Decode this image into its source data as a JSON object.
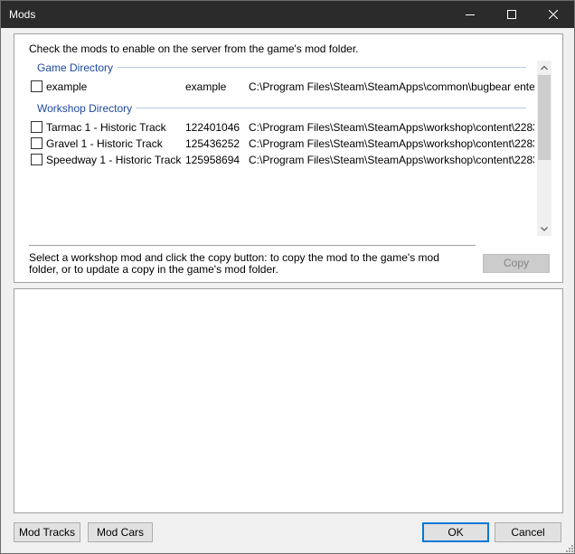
{
  "window": {
    "title": "Mods"
  },
  "instructions": "Check the mods to enable on the server from the game's mod folder.",
  "groups": {
    "game": {
      "title": "Game Directory",
      "rows": [
        {
          "name": "example",
          "id": "example",
          "path": "C:\\Program Files\\Steam\\SteamApps\\common\\bugbear entert...",
          "checked": false
        }
      ]
    },
    "workshop": {
      "title": "Workshop Directory",
      "rows": [
        {
          "name": "Tarmac 1 - Historic Track",
          "id": "122401046",
          "path": "C:\\Program Files\\Steam\\SteamApps\\workshop\\content\\2283...",
          "checked": false
        },
        {
          "name": "Gravel 1 - Historic Track",
          "id": "125436252",
          "path": "C:\\Program Files\\Steam\\SteamApps\\workshop\\content\\2283...",
          "checked": false
        },
        {
          "name": "Speedway 1 - Historic Track",
          "id": "125958694",
          "path": "C:\\Program Files\\Steam\\SteamApps\\workshop\\content\\2283...",
          "checked": false
        }
      ]
    }
  },
  "hint": "Select a workshop mod and click the copy button: to copy the mod to the game's mod folder, or to update a copy in the game's mod folder.",
  "buttons": {
    "copy": "Copy",
    "mod_tracks": "Mod Tracks",
    "mod_cars": "Mod Cars",
    "ok": "OK",
    "cancel": "Cancel"
  }
}
